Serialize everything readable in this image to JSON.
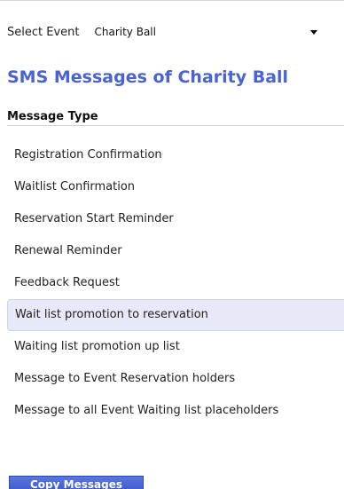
{
  "event_selector": {
    "label": "Select Event",
    "selected": "Charity Ball"
  },
  "page_title": "SMS Messages of Charity Ball",
  "table": {
    "header": "Message Type",
    "rows": [
      "Registration Confirmation",
      "Waitlist Confirmation",
      "Reservation Start Reminder",
      "Renewal Reminder",
      "Feedback Request",
      "Wait list promotion to reservation",
      "Waiting list promotion up list",
      "Message to Event Reservation holders",
      "Message to all Event Waiting list placeholders"
    ],
    "selected_index": 5
  },
  "actions": {
    "copy_label": "Copy Messages"
  },
  "colors": {
    "title": "#4a63d3",
    "selected_row_bg": "#e7e9f8",
    "button_bg": "#3953c8"
  }
}
